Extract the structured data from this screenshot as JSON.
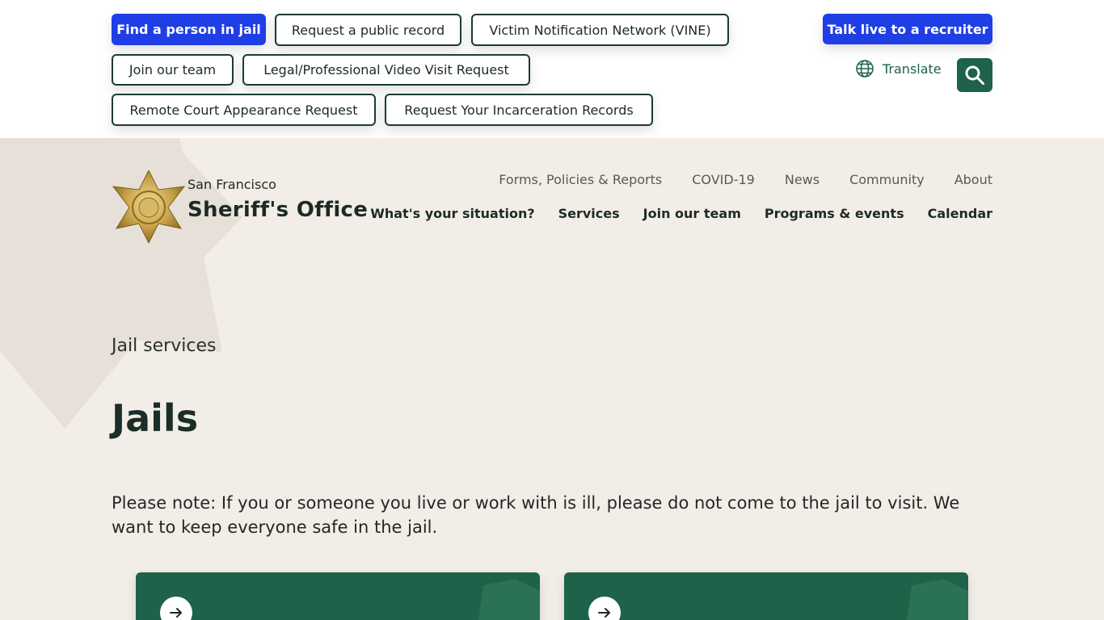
{
  "utility_links": {
    "find_person": "Find a person in jail",
    "public_record": "Request a public record",
    "vine": "Victim Notification Network (VINE)",
    "join_team": "Join our team",
    "video_visit": "Legal/Professional Video Visit Request",
    "remote_court": "Remote Court Appearance Request",
    "incarceration_records": "Request Your Incarceration Records",
    "recruiter": "Talk live to a recruiter"
  },
  "translate_label": "Translate",
  "search_label": "Search",
  "logo": {
    "subtitle": "San Francisco",
    "title": "Sheriff's Office"
  },
  "secondary_nav": [
    "Forms, Policies & Reports",
    "COVID-19",
    "News",
    "Community",
    "About"
  ],
  "main_nav": [
    "What's your situation?",
    "Services",
    "Join our team",
    "Programs & events",
    "Calendar"
  ],
  "breadcrumb": "Jail services",
  "page_title": "Jails",
  "note": "Please note: If you or someone you live or work with is ill, please do not come to the jail to visit. We want to keep everyone safe in the jail.",
  "colors": {
    "primary_blue": "#1f3ee5",
    "brand_green": "#1e6249",
    "hero_bg": "#f2ede7"
  }
}
